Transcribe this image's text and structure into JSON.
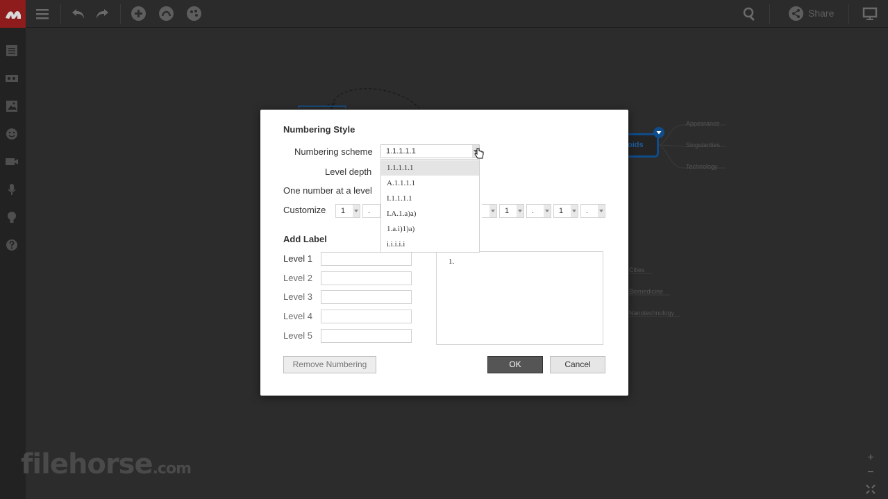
{
  "toolbar": {
    "share_label": "Share"
  },
  "map": {
    "central_label": "oids",
    "right_branches": [
      "Appearance",
      "Singularities",
      "Technology"
    ],
    "lower_branches": [
      "Cities",
      "Biomedicine",
      "Nanotechnology"
    ]
  },
  "watermark": {
    "main": "filehorse",
    "suffix": ".com"
  },
  "dialog": {
    "section_numbering": "Numbering Style",
    "numbering_scheme_label": "Numbering scheme",
    "numbering_scheme_value": "1.1.1.1.1",
    "level_depth_label": "Level depth",
    "one_number_label": "One number at a level",
    "customize_label": "Customize",
    "customize_fields": [
      {
        "value": "1"
      },
      {
        "value": "."
      },
      {
        "value": ""
      },
      {
        "value": "1"
      },
      {
        "value": "."
      },
      {
        "value": "1"
      },
      {
        "value": "."
      }
    ],
    "section_label": "Add Label",
    "levels": [
      "Level 1",
      "Level 2",
      "Level 3",
      "Level 4",
      "Level 5"
    ],
    "preview_text": "1.",
    "remove_button": "Remove Numbering",
    "ok_button": "OK",
    "cancel_button": "Cancel"
  },
  "dropdown": {
    "options": [
      "1.1.1.1.1",
      "A.1.1.1.1",
      "I.1.1.1.1",
      "I.A.1.a)a)",
      "1.a.i)1)a)",
      "i.i.i.i.i"
    ],
    "selected_index": 0
  },
  "colors": {
    "dialog_bg": "#ffffff",
    "ok_bg": "#555555",
    "central_border": "#0f4c8a",
    "app_bg": "#2c2c2c"
  }
}
